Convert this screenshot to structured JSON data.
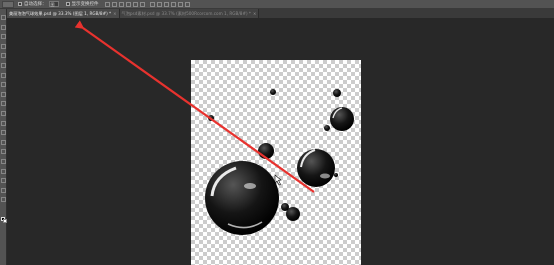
{
  "options_bar": {
    "auto_select_label": "自动选择：",
    "auto_select_value": "图",
    "show_transform_label": "显示变换控件"
  },
  "tabs": [
    {
      "label": "美丽泡泡气球效果.psd @ 33.3% (图层 1, RGB/8#) *",
      "active": true
    },
    {
      "label": "气泡psd素材.psd @ 33.7% (素材500Rcorcom.com 1, RGB/8#) *",
      "active": false
    }
  ],
  "toolbar": {
    "icons": [
      "move-icon",
      "marquee-icon",
      "lasso-icon",
      "quick-select-icon",
      "crop-icon",
      "eyedropper-icon",
      "healing-icon",
      "brush-icon",
      "stamp-icon",
      "history-brush-icon",
      "eraser-icon",
      "gradient-icon",
      "blur-icon",
      "dodge-icon",
      "pen-icon",
      "type-icon",
      "path-select-icon",
      "shape-icon",
      "hand-icon",
      "zoom-icon"
    ]
  },
  "colors": {
    "annotation_arrow": "#e8322e",
    "foreground": "#000000",
    "background": "#ffffff"
  }
}
